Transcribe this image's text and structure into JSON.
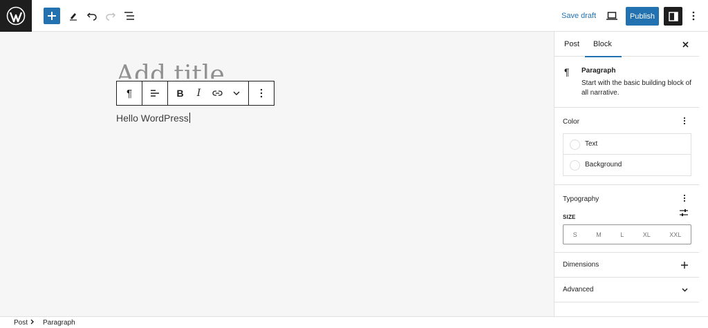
{
  "topbar": {
    "logo_icon": "wordpress-logo-icon",
    "save_draft_label": "Save draft",
    "publish_label": "Publish",
    "accent_color": "#2271b1"
  },
  "editor": {
    "title_placeholder": "Add title",
    "paragraph_text": "Hello WordPress"
  },
  "sidebar": {
    "tabs": [
      {
        "label": "Post"
      },
      {
        "label": "Block"
      }
    ],
    "block_card": {
      "title": "Paragraph",
      "description": "Start with the basic building block of all narrative."
    },
    "color": {
      "title": "Color",
      "items": [
        {
          "label": "Text"
        },
        {
          "label": "Background"
        }
      ]
    },
    "typography": {
      "title": "Typography",
      "size_label": "SIZE",
      "sizes": [
        "S",
        "M",
        "L",
        "XL",
        "XXL"
      ]
    },
    "dimensions": {
      "title": "Dimensions"
    },
    "advanced": {
      "title": "Advanced"
    }
  },
  "footer": {
    "breadcrumbs": [
      {
        "label": "Post"
      },
      {
        "label": "Paragraph"
      }
    ]
  }
}
